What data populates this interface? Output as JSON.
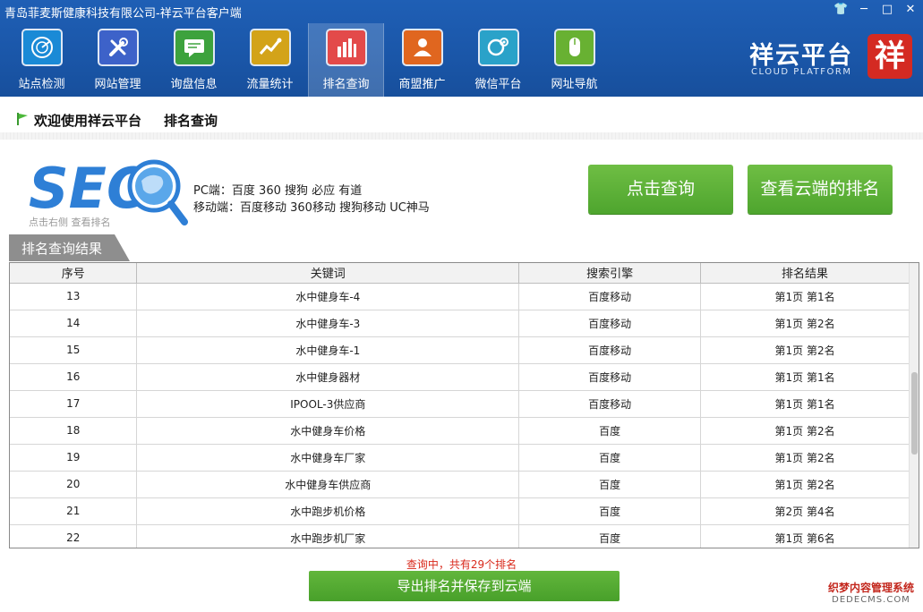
{
  "window": {
    "title": "青岛菲麦斯健康科技有限公司-祥云平台客户端"
  },
  "toolbar": {
    "items": [
      {
        "label": "站点检测",
        "icon": "radar-icon",
        "color": "#1a8ad6"
      },
      {
        "label": "网站管理",
        "icon": "tools-icon",
        "color": "#3d62c9"
      },
      {
        "label": "询盘信息",
        "icon": "message-icon",
        "color": "#3da23d"
      },
      {
        "label": "流量统计",
        "icon": "trend-chart-icon",
        "color": "#d3a319"
      },
      {
        "label": "排名查询",
        "icon": "bar-chart-icon",
        "color": "#e34a4a"
      },
      {
        "label": "商盟推广",
        "icon": "users-icon",
        "color": "#e0661f"
      },
      {
        "label": "微信平台",
        "icon": "wechat-icon",
        "color": "#2aa2c9"
      },
      {
        "label": "网址导航",
        "icon": "mouse-icon",
        "color": "#68b132"
      }
    ],
    "active_index": 4
  },
  "brand": {
    "name": "祥云平台",
    "subtitle": "CLOUD PLATFORM",
    "logo_char": "祥"
  },
  "welcome": {
    "text": "欢迎使用祥云平台",
    "page": "排名查询"
  },
  "seo": {
    "logo_text": "SEO",
    "hint": "点击右侧 查看排名",
    "pc_engines": "PC端：百度 360 搜狗 必应 有道",
    "mobile_engines": "移动端：百度移动 360移动 搜狗移动 UC神马"
  },
  "buttons": {
    "query": "点击查询",
    "cloud_rank": "查看云端的排名",
    "export": "导出排名并保存到云端"
  },
  "section": {
    "title": "排名查询结果"
  },
  "table": {
    "columns": [
      "序号",
      "关键词",
      "搜索引擎",
      "排名结果"
    ],
    "rows": [
      [
        "13",
        "水中健身车-4",
        "百度移动",
        "第1页 第1名"
      ],
      [
        "14",
        "水中健身车-3",
        "百度移动",
        "第1页 第2名"
      ],
      [
        "15",
        "水中健身车-1",
        "百度移动",
        "第1页 第2名"
      ],
      [
        "16",
        "水中健身器材",
        "百度移动",
        "第1页 第1名"
      ],
      [
        "17",
        "IPOOL-3供应商",
        "百度移动",
        "第1页 第1名"
      ],
      [
        "18",
        "水中健身车价格",
        "百度",
        "第1页 第2名"
      ],
      [
        "19",
        "水中健身车厂家",
        "百度",
        "第1页 第2名"
      ],
      [
        "20",
        "水中健身车供应商",
        "百度",
        "第1页 第2名"
      ],
      [
        "21",
        "水中跑步机价格",
        "百度",
        "第2页 第4名"
      ],
      [
        "22",
        "水中跑步机厂家",
        "百度",
        "第1页 第6名"
      ]
    ]
  },
  "status": {
    "text": "查询中，共有29个排名"
  },
  "watermark": {
    "line1": "织梦内容管理系统",
    "line2": "DEDECMS.COM"
  }
}
